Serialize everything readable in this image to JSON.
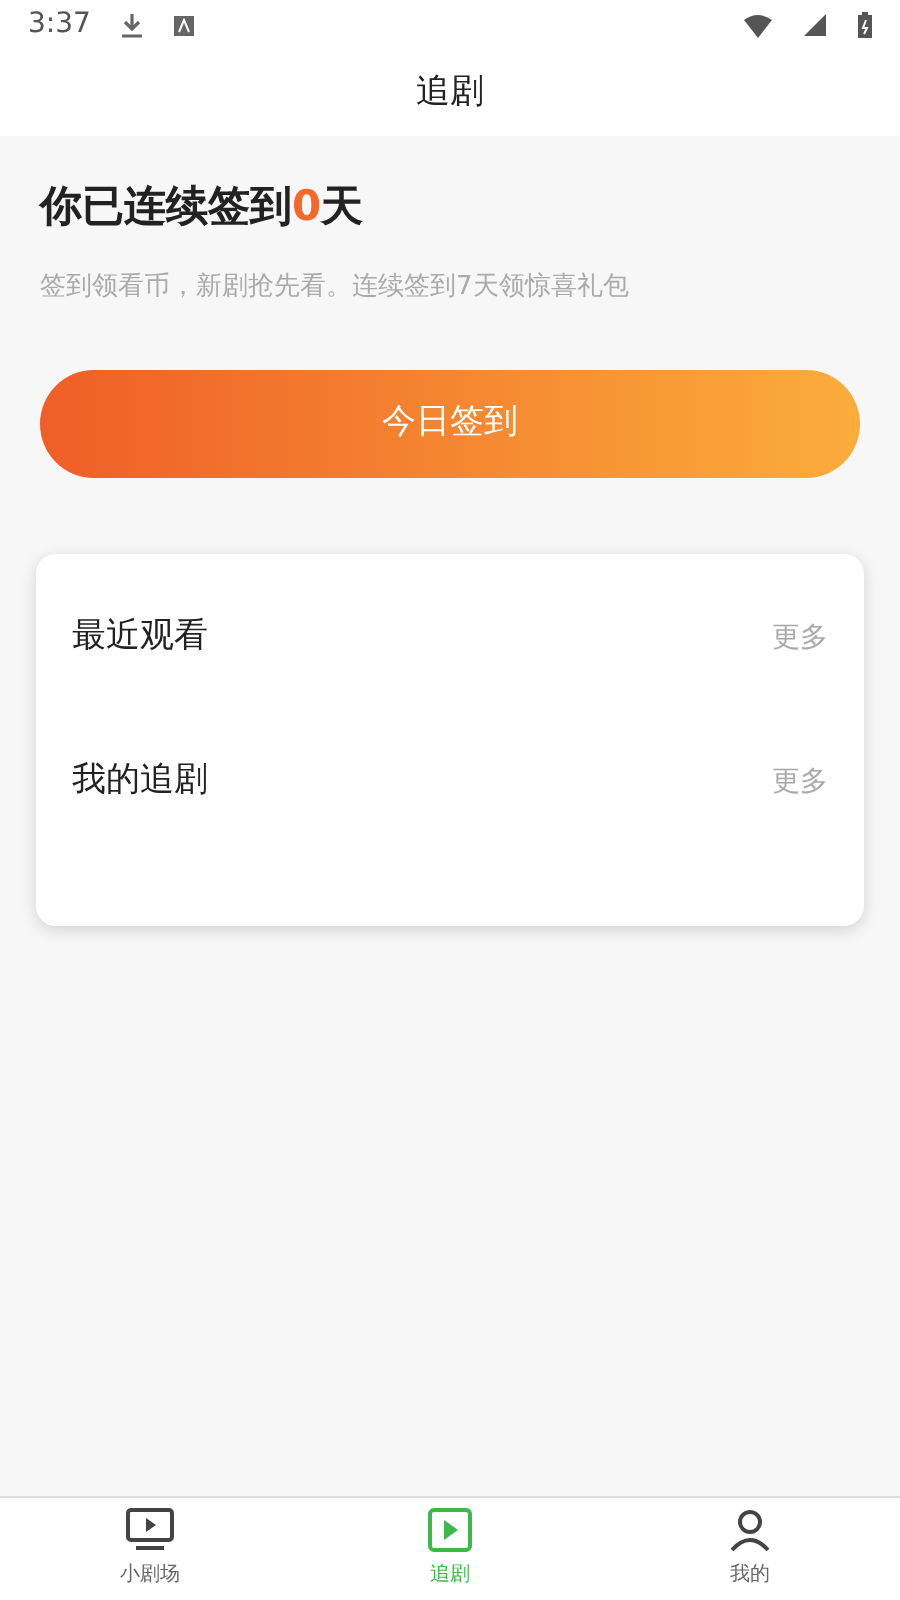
{
  "status_bar": {
    "time": "3:37"
  },
  "header": {
    "title": "追剧"
  },
  "checkin": {
    "title_prefix": "你已连续签到",
    "days": "0",
    "title_suffix": "天",
    "subtitle": "签到领看币，新剧抢先看。连续签到7天领惊喜礼包",
    "button": "今日签到"
  },
  "sections": [
    {
      "title": "最近观看",
      "more": "更多"
    },
    {
      "title": "我的追剧",
      "more": "更多"
    }
  ],
  "tabs": [
    {
      "label": "小剧场",
      "kind": "tv",
      "selected": false
    },
    {
      "label": "追剧",
      "kind": "play",
      "selected": true
    },
    {
      "label": "我的",
      "kind": "person",
      "selected": false
    }
  ]
}
